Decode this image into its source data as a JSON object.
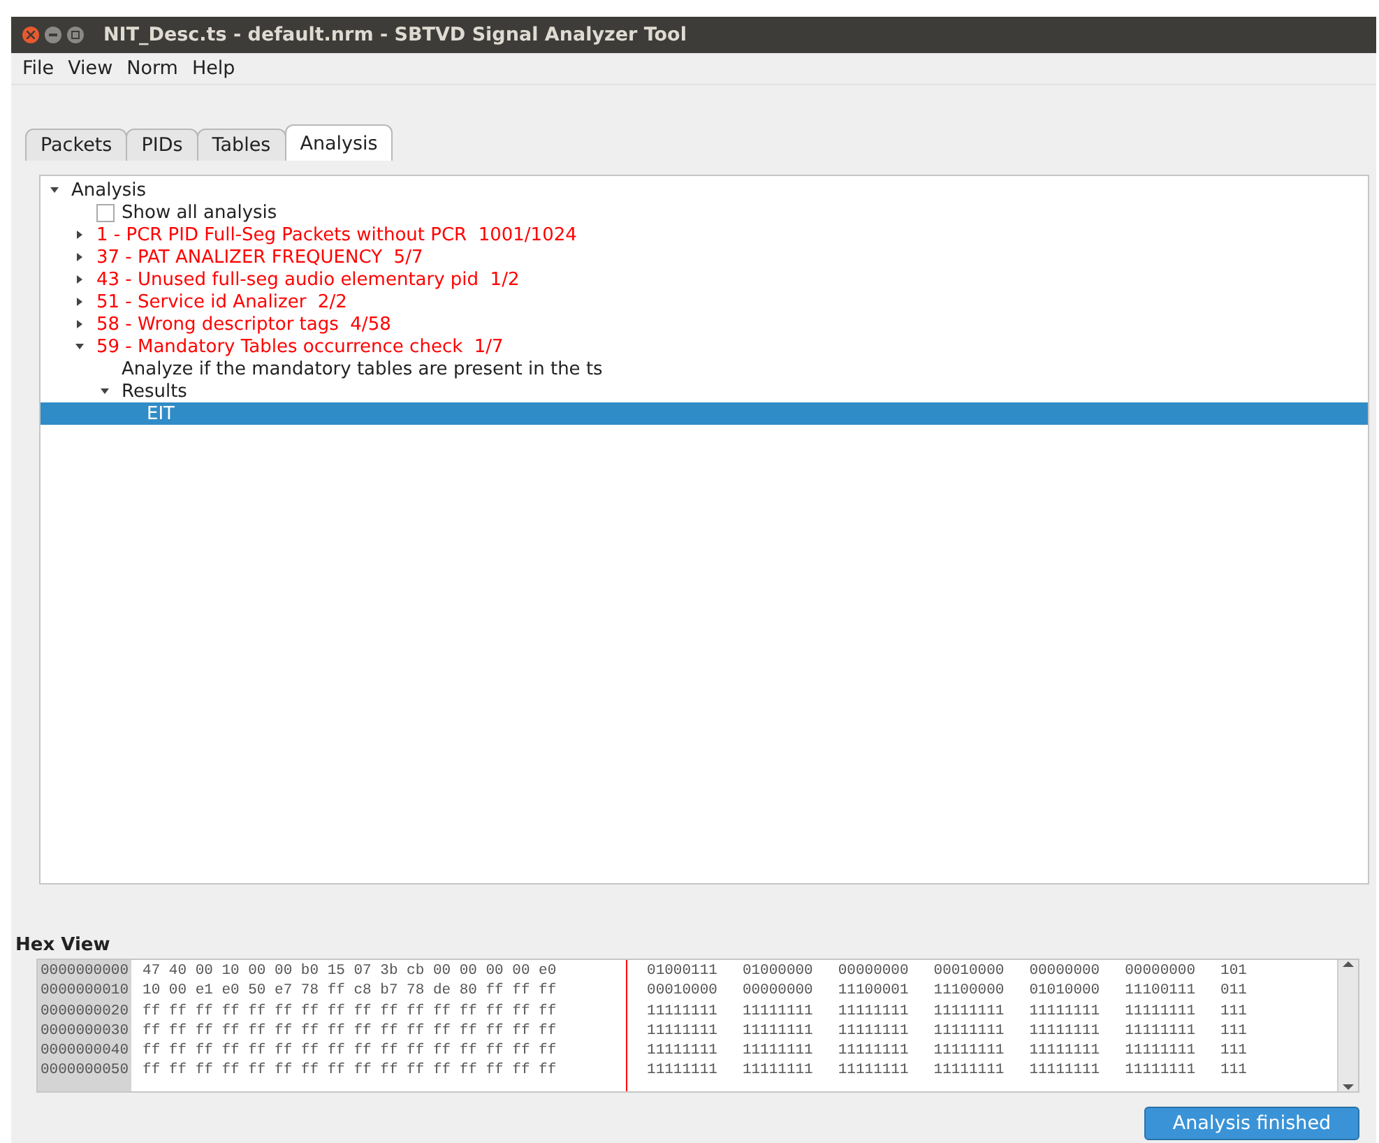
{
  "window": {
    "title": "NIT_Desc.ts - default.nrm - SBTVD Signal Analyzer Tool"
  },
  "menu": [
    "File",
    "View",
    "Norm",
    "Help"
  ],
  "tabs": [
    {
      "label": "Packets",
      "selected": false
    },
    {
      "label": "PIDs",
      "selected": false
    },
    {
      "label": "Tables",
      "selected": false
    },
    {
      "label": "Analysis",
      "selected": true
    }
  ],
  "tree": [
    {
      "label": "Analysis",
      "expanded": true,
      "selected": false,
      "children": [
        {
          "kind": "checkbox",
          "label": "Show all analysis",
          "checked": false
        },
        {
          "kind": "error",
          "label": "1 - PCR PID Full-Seg Packets without PCR  1001/1024",
          "expanded": false,
          "selected": false
        },
        {
          "kind": "error",
          "label": "37 - PAT ANALIZER FREQUENCY  5/7",
          "expanded": false,
          "selected": false
        },
        {
          "kind": "error",
          "label": "43 - Unused full-seg audio elementary pid  1/2",
          "expanded": false,
          "selected": false
        },
        {
          "kind": "error",
          "label": "51 - Service id Analizer  2/2",
          "expanded": false,
          "selected": false
        },
        {
          "kind": "error",
          "label": "58 - Wrong descriptor tags  4/58",
          "expanded": false,
          "selected": false
        },
        {
          "kind": "error",
          "label": "59 - Mandatory Tables occurrence check  1/7",
          "expanded": true,
          "selected": false,
          "children": [
            {
              "label": "Analyze if the mandatory tables are present in the ts",
              "selected": false
            },
            {
              "label": "Results",
              "expanded": true,
              "selected": false,
              "children": [
                {
                  "label": "EIT",
                  "selected": true
                }
              ]
            }
          ]
        }
      ]
    }
  ],
  "hex_view": {
    "title": "Hex View",
    "rows": [
      {
        "address": "0000000000",
        "hex": "47 40 00 10 00 00 b0 15 07 3b cb 00 00 00 00 e0",
        "binary": [
          "01000111",
          "01000000",
          "00000000",
          "00010000",
          "00000000",
          "00000000",
          "101"
        ]
      },
      {
        "address": "0000000010",
        "hex": "10 00 e1 e0 50 e7 78 ff c8 b7 78 de 80 ff ff ff",
        "binary": [
          "00010000",
          "00000000",
          "11100001",
          "11100000",
          "01010000",
          "11100111",
          "011"
        ]
      },
      {
        "address": "0000000020",
        "hex": "ff ff ff ff ff ff ff ff ff ff ff ff ff ff ff ff",
        "binary": [
          "11111111",
          "11111111",
          "11111111",
          "11111111",
          "11111111",
          "11111111",
          "111"
        ]
      },
      {
        "address": "0000000030",
        "hex": "ff ff ff ff ff ff ff ff ff ff ff ff ff ff ff ff",
        "binary": [
          "11111111",
          "11111111",
          "11111111",
          "11111111",
          "11111111",
          "11111111",
          "111"
        ]
      },
      {
        "address": "0000000040",
        "hex": "ff ff ff ff ff ff ff ff ff ff ff ff ff ff ff ff",
        "binary": [
          "11111111",
          "11111111",
          "11111111",
          "11111111",
          "11111111",
          "11111111",
          "111"
        ]
      },
      {
        "address": "0000000050",
        "hex": "ff ff ff ff ff ff ff ff ff ff ff ff ff ff ff ff",
        "binary": [
          "11111111",
          "11111111",
          "11111111",
          "11111111",
          "11111111",
          "11111111",
          "111"
        ]
      }
    ]
  },
  "status_button": "Analysis finished"
}
